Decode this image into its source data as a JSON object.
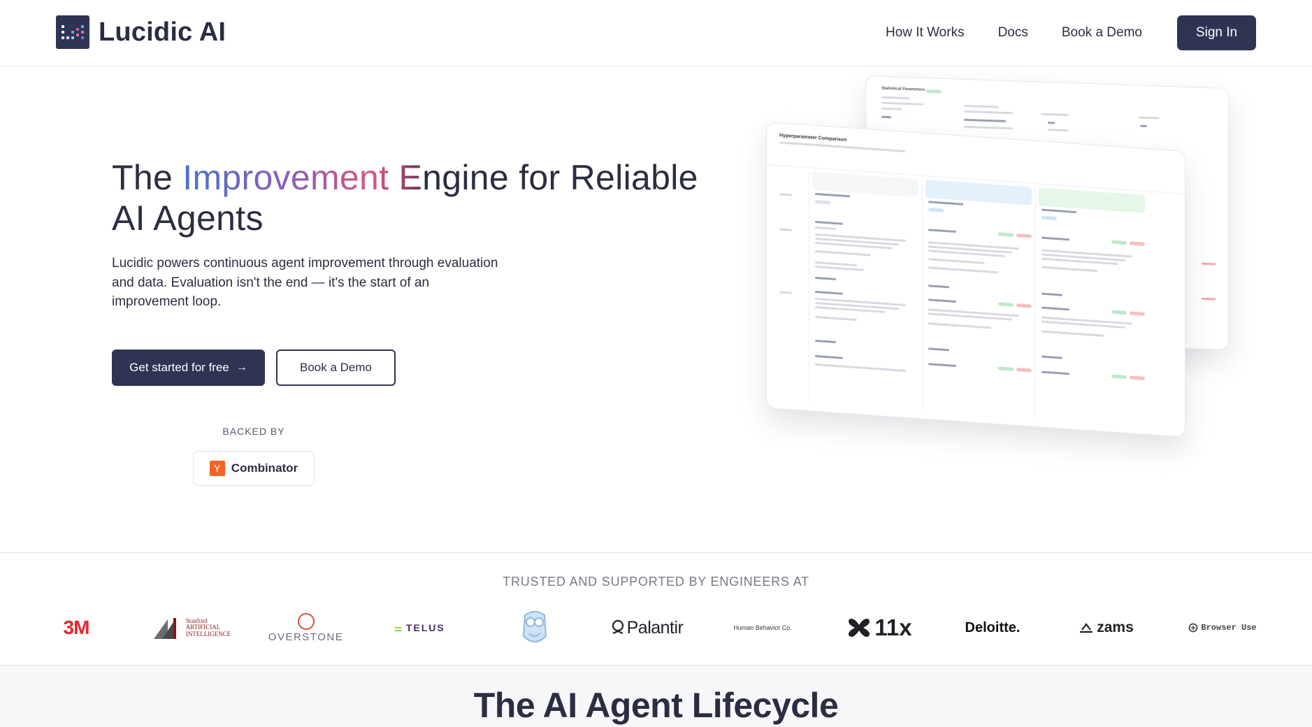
{
  "header": {
    "logo_text": "Lucidic AI",
    "nav": [
      "How It Works",
      "Docs",
      "Book a Demo"
    ],
    "signin_label": "Sign In"
  },
  "hero": {
    "title_part1": "The ",
    "title_gradient": "Improvement E",
    "title_part2": "ngine for Reliable AI Agents",
    "subtitle": "Lucidic powers continuous agent improvement through evaluation and data. Evaluation isn't the end — it's the start of an improvement loop.",
    "primary_cta": "Get started for free",
    "secondary_cta": "Book a Demo",
    "backed_by_label": "BACKED BY",
    "backer_icon": "Y",
    "backer_name": "Combinator"
  },
  "screenshot": {
    "front_title": "Hyperparameter Comparison",
    "back_title": "Statistical Parameters"
  },
  "trusted": {
    "label": "TRUSTED AND SUPPORTED BY ENGINEERS AT",
    "logos": {
      "m3": "3M",
      "stanford": [
        "Stanford",
        "ARTIFICIAL",
        "INTELLIGENCE"
      ],
      "overstone": "OVERSTONE",
      "telus": "TELUS",
      "palantir": "Palantir",
      "hbc": "Human Behavior Co.",
      "x11": "11x",
      "deloitte": "Deloitte.",
      "zams": "zams",
      "browser": "Browser Use"
    }
  },
  "lifecycle": {
    "title": "The AI Agent Lifecycle"
  },
  "colors": {
    "primary": "#2e3452",
    "text": "#2b2d42",
    "muted": "#767887",
    "accent_red": "#e6282a",
    "yc_orange": "#f26522"
  }
}
